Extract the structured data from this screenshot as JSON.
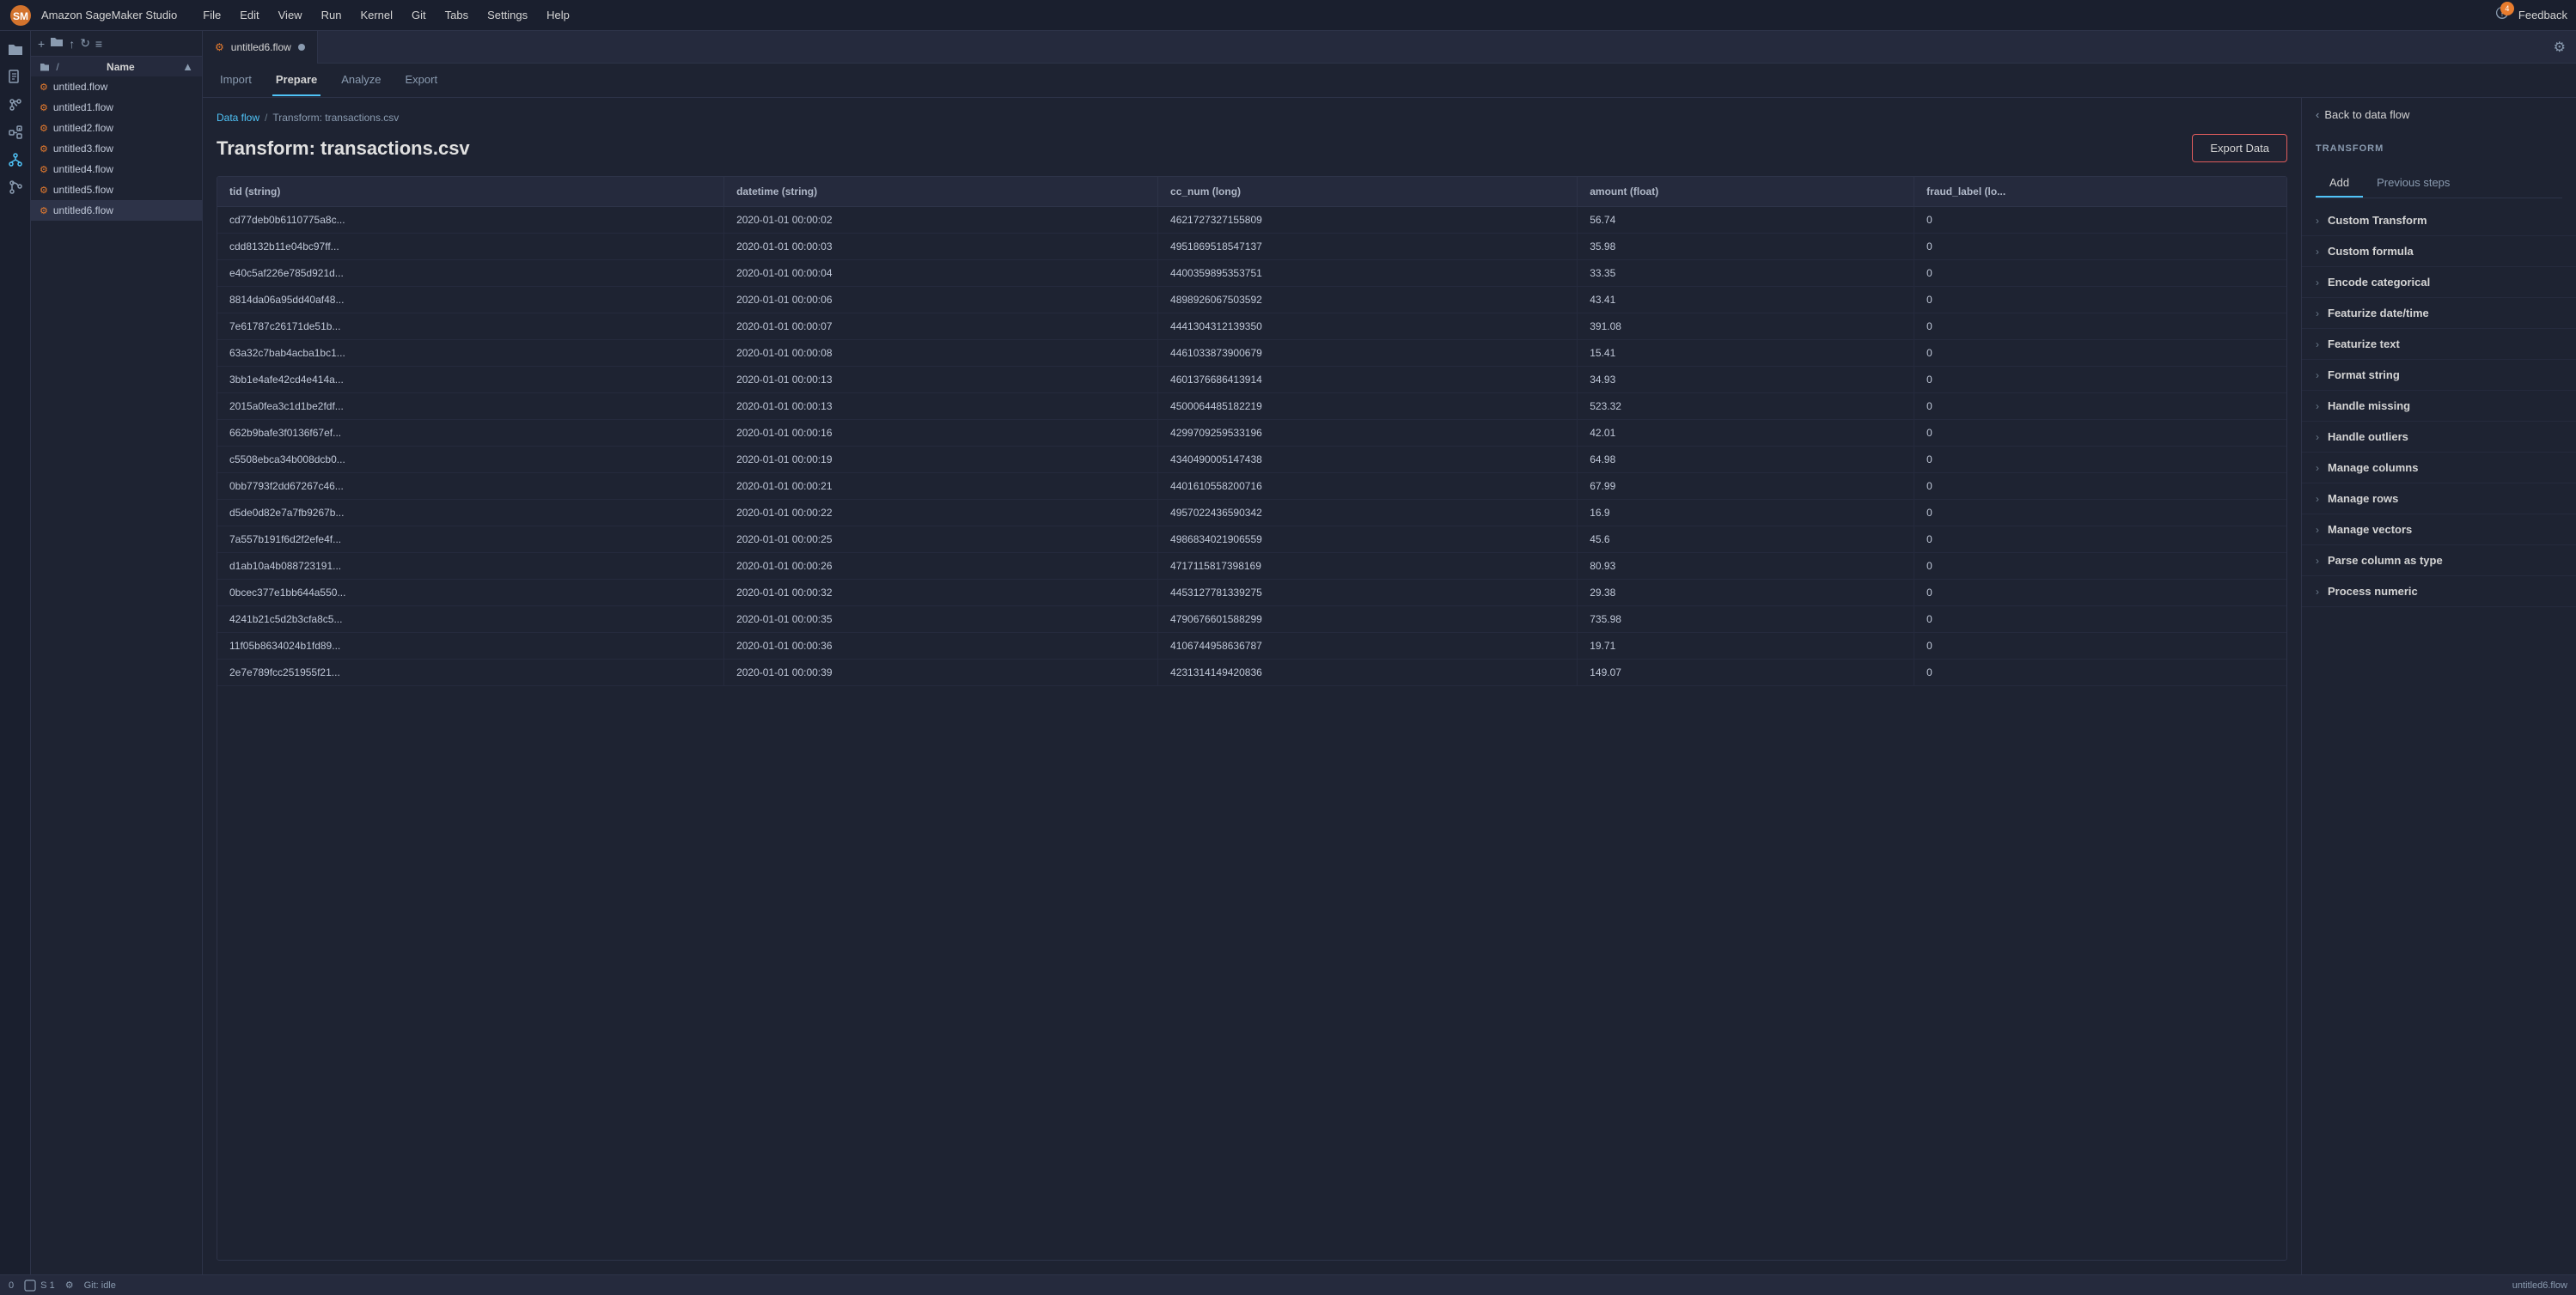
{
  "app": {
    "title": "Amazon SageMaker Studio",
    "feedback_label": "Feedback",
    "notification_count": "4"
  },
  "menu": {
    "items": [
      "File",
      "Edit",
      "View",
      "Run",
      "Kernel",
      "Git",
      "Tabs",
      "Settings",
      "Help"
    ]
  },
  "icon_sidebar": {
    "icons": [
      "folder",
      "search",
      "git",
      "puzzle",
      "nodes",
      "branch"
    ]
  },
  "file_panel": {
    "root_label": "/",
    "name_label": "Name",
    "files": [
      {
        "name": "untitled.flow"
      },
      {
        "name": "untitled1.flow"
      },
      {
        "name": "untitled2.flow"
      },
      {
        "name": "untitled3.flow"
      },
      {
        "name": "untitled4.flow"
      },
      {
        "name": "untitled5.flow"
      },
      {
        "name": "untitled6.flow"
      }
    ]
  },
  "tab": {
    "label": "untitled6.flow",
    "flow_icon": "⚙"
  },
  "sub_nav": {
    "items": [
      "Import",
      "Prepare",
      "Analyze",
      "Export"
    ],
    "active": "Prepare"
  },
  "breadcrumb": {
    "link": "Data flow",
    "separator": "/",
    "current": "Transform: transactions.csv"
  },
  "page_title": "Transform: transactions.csv",
  "export_button": "Export Data",
  "table": {
    "columns": [
      "tid (string)",
      "datetime (string)",
      "cc_num (long)",
      "amount (float)",
      "fraud_label (lo..."
    ],
    "rows": [
      [
        "cd77deb0b6110775a8c...",
        "2020-01-01 00:00:02",
        "4621727327155809",
        "56.74",
        "0"
      ],
      [
        "cdd8132b11e04bc97ff...",
        "2020-01-01 00:00:03",
        "4951869518547137",
        "35.98",
        "0"
      ],
      [
        "e40c5af226e785d921d...",
        "2020-01-01 00:00:04",
        "4400359895353751",
        "33.35",
        "0"
      ],
      [
        "8814da06a95dd40af48...",
        "2020-01-01 00:00:06",
        "4898926067503592",
        "43.41",
        "0"
      ],
      [
        "7e61787c26171de51b...",
        "2020-01-01 00:00:07",
        "4441304312139350",
        "391.08",
        "0"
      ],
      [
        "63a32c7bab4acba1bc1...",
        "2020-01-01 00:00:08",
        "4461033873900679",
        "15.41",
        "0"
      ],
      [
        "3bb1e4afe42cd4e414a...",
        "2020-01-01 00:00:13",
        "4601376686413914",
        "34.93",
        "0"
      ],
      [
        "2015a0fea3c1d1be2fdf...",
        "2020-01-01 00:00:13",
        "4500064485182219",
        "523.32",
        "0"
      ],
      [
        "662b9bafe3f0136f67ef...",
        "2020-01-01 00:00:16",
        "4299709259533196",
        "42.01",
        "0"
      ],
      [
        "c5508ebca34b008dcb0...",
        "2020-01-01 00:00:19",
        "4340490005147438",
        "64.98",
        "0"
      ],
      [
        "0bb7793f2dd67267c46...",
        "2020-01-01 00:00:21",
        "4401610558200716",
        "67.99",
        "0"
      ],
      [
        "d5de0d82e7a7fb9267b...",
        "2020-01-01 00:00:22",
        "4957022436590342",
        "16.9",
        "0"
      ],
      [
        "7a557b191f6d2f2efe4f...",
        "2020-01-01 00:00:25",
        "4986834021906559",
        "45.6",
        "0"
      ],
      [
        "d1ab10a4b088723191...",
        "2020-01-01 00:00:26",
        "4717115817398169",
        "80.93",
        "0"
      ],
      [
        "0bcec377e1bb644a550...",
        "2020-01-01 00:00:32",
        "4453127781339275",
        "29.38",
        "0"
      ],
      [
        "4241b21c5d2b3cfa8c5...",
        "2020-01-01 00:00:35",
        "4790676601588299",
        "735.98",
        "0"
      ],
      [
        "11f05b8634024b1fd89...",
        "2020-01-01 00:00:36",
        "4106744958636787",
        "19.71",
        "0"
      ],
      [
        "2e7e789fcc251955f21...",
        "2020-01-01 00:00:39",
        "4231314149420836",
        "149.07",
        "0"
      ]
    ]
  },
  "transform_panel": {
    "label": "TRANSFORM",
    "tabs": [
      "Add",
      "Previous steps"
    ],
    "active_tab": "Add",
    "back_label": "Back to data flow",
    "items": [
      "Custom Transform",
      "Custom formula",
      "Encode categorical",
      "Featurize date/time",
      "Featurize text",
      "Format string",
      "Handle missing",
      "Handle outliers",
      "Manage columns",
      "Manage rows",
      "Manage vectors",
      "Parse column as type",
      "Process numeric"
    ]
  },
  "status_bar": {
    "left": [
      "0",
      "S 1"
    ],
    "git_status": "Git: idle",
    "right": "untitled6.flow"
  }
}
